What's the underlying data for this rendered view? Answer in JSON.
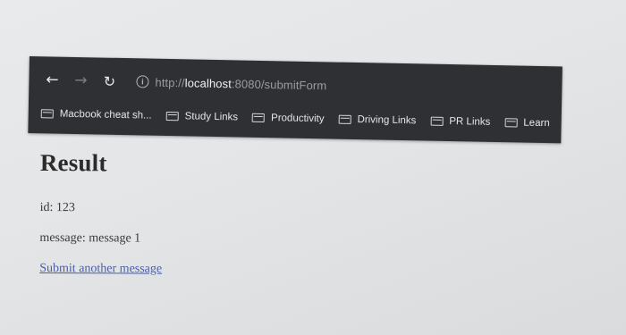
{
  "browser": {
    "nav": {
      "back_icon": "arrow-left-icon",
      "forward_icon": "arrow-right-icon",
      "reload_icon": "reload-icon"
    },
    "address": {
      "scheme": "http://",
      "host": "localhost",
      "path": ":8080/submitForm"
    },
    "bookmarks": [
      {
        "label": "Macbook cheat sh..."
      },
      {
        "label": "Study Links"
      },
      {
        "label": "Productivity"
      },
      {
        "label": "Driving Links"
      },
      {
        "label": "PR Links"
      },
      {
        "label": "Learn"
      }
    ]
  },
  "page": {
    "title": "Result",
    "id_line": "id: 123",
    "message_line": "message: message 1",
    "link_text": "Submit another message"
  },
  "colors": {
    "chrome_bg": "#2e3034",
    "link": "#4a5fa8",
    "page_bg": "#e6e7e9"
  }
}
